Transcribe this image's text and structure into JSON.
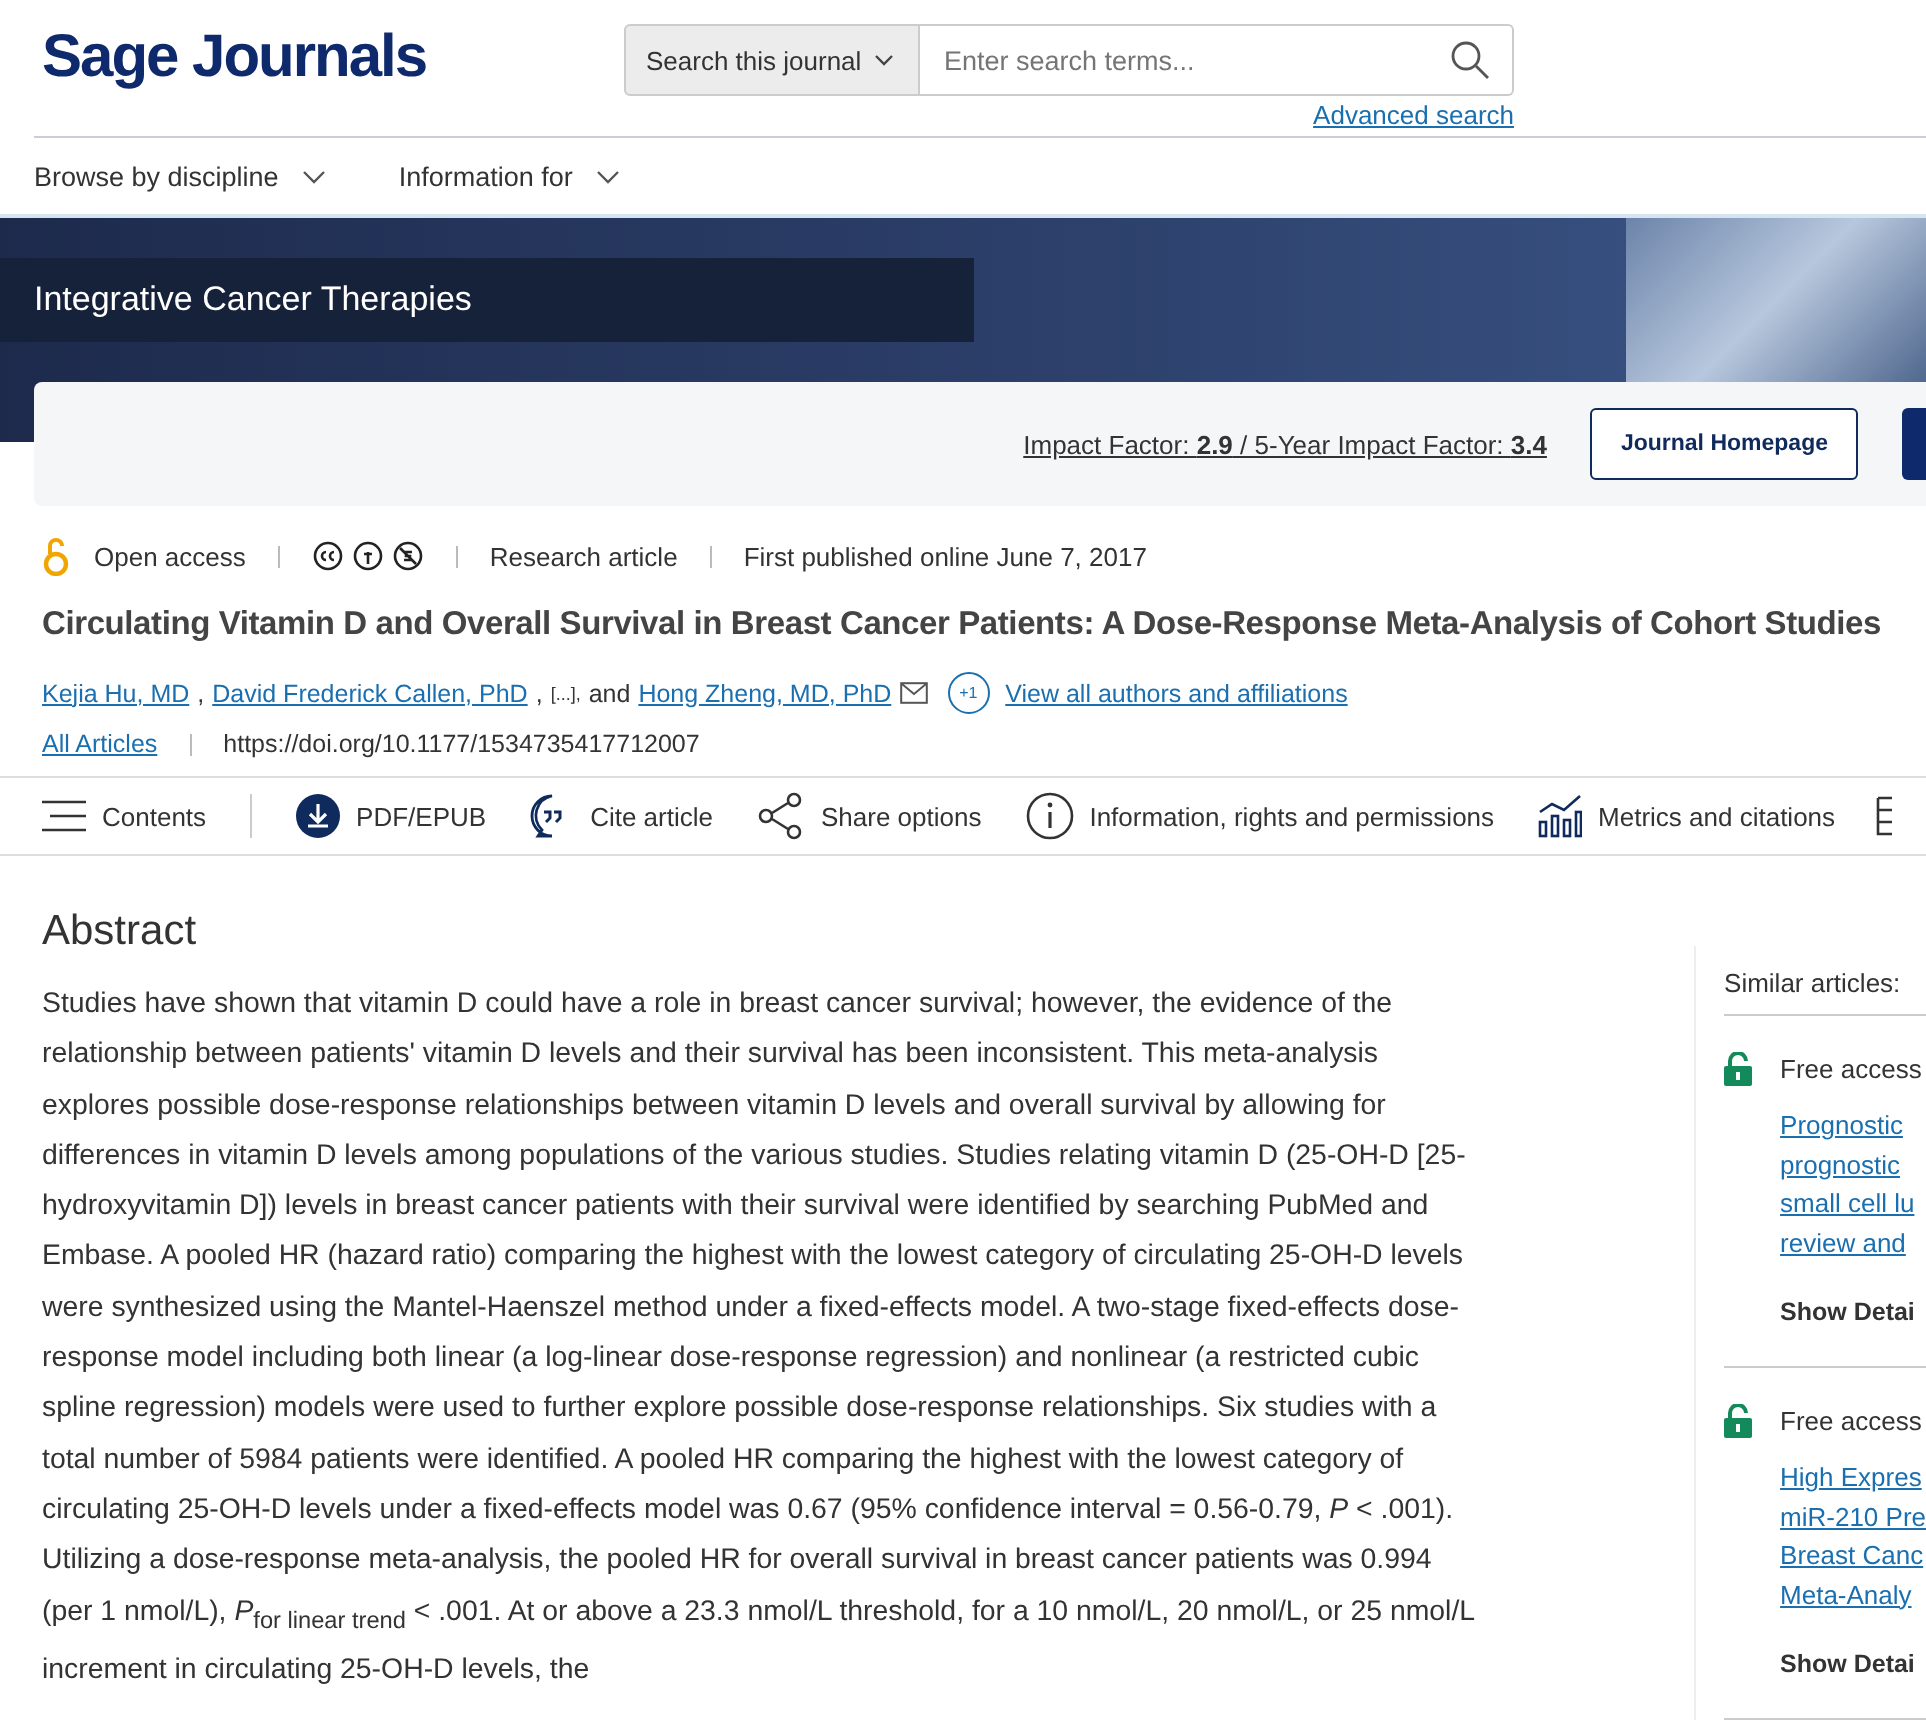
{
  "header": {
    "logo": "Sage Journals",
    "search_scope": "Search this journal",
    "search": {
      "placeholder": "Enter search terms..."
    },
    "advanced_search": "Advanced search"
  },
  "nav": [
    "Browse by discipline",
    "Information for"
  ],
  "banner": {
    "journal": "Integrative Cancer Therapies"
  },
  "metrics": {
    "impact_label": "Impact Factor:",
    "impact_value": "2.9",
    "separator": "/",
    "five_year_label": "5-Year Impact Factor:",
    "five_year_value": "3.4",
    "homepage_button": "Journal Homepage"
  },
  "meta": {
    "access": "Open access",
    "type": "Research article",
    "published": "First published online June 7, 2017"
  },
  "title": "Circulating Vitamin D and Overall Survival in Breast Cancer Patients: A Dose-Response Meta-Analysis of Cohort Studies",
  "authors": [
    {
      "name": "Kejia Hu, MD",
      "sep": ","
    },
    {
      "name": "David Frederick Callen, PhD",
      "sep": ","
    }
  ],
  "ellipsis": "[...],",
  "and": "and",
  "last_author": "Hong Zheng, MD, PhD",
  "more_count": "+1",
  "view_all": "View all authors and affiliations",
  "all_articles": "All Articles",
  "doi": "https://doi.org/10.1177/1534735417712007",
  "toolbar": [
    {
      "kind": "contents",
      "label": "Contents"
    },
    {
      "kind": "pdf",
      "label": "PDF/EPUB"
    },
    {
      "kind": "cite",
      "label": "Cite article"
    },
    {
      "kind": "share",
      "label": "Share options"
    },
    {
      "kind": "info",
      "label": "Information, rights and permissions"
    },
    {
      "kind": "metrics",
      "label": "Metrics and citations"
    }
  ],
  "abstract": {
    "heading": "Abstract",
    "text": "Studies have shown that vitamin D could have a role in breast cancer survival; however, the evidence of the relationship between patients' vitamin D levels and their survival has been inconsistent. This meta-analysis explores possible dose-response relationships between vitamin D levels and overall survival by allowing for differences in vitamin D levels among populations of the various studies. Studies relating vitamin D (25-OH-D [25-hydroxyvitamin D]) levels in breast cancer patients with their survival were identified by searching PubMed and Embase. A pooled HR (hazard ratio) comparing the highest with the lowest category of circulating 25-OH-D levels were synthesized using the Mantel-Haenszel method under a fixed-effects model. A two-stage fixed-effects dose-response model including both linear (a log-linear dose-response regression) and nonlinear (a restricted cubic spline regression) models were used to further explore possible dose-response relationships. Six studies with a total number of 5984 patients were identified. A pooled HR comparing the highest with the lowest category of circulating 25-OH-D levels under a fixed-effects model was 0.67 (95% confidence interval = 0.56-0.79, *P* < .001). Utilizing a dose-response meta-analysis, the pooled HR for overall survival in breast cancer patients was 0.994 (per 1 nmol/L), *P*$_{for linear trend}$ < .001. At or above a 23.3 nmol/L threshold, for a 10 nmol/L, 20 nmol/L, or 25 nmol/L increment in circulating 25-OH-D levels, the"
  },
  "similar": {
    "heading": "Similar articles:",
    "items": [
      {
        "access": "Free access",
        "title_lines": [
          "Prognostic",
          "prognostic",
          "small cell lu",
          "review and"
        ],
        "details": "Show Detai"
      },
      {
        "access": "Free access",
        "title_lines": [
          "High Expres",
          "miR-210 Pre",
          "Breast Canc",
          "Meta-Analy"
        ],
        "details": "Show Detai"
      }
    ]
  }
}
